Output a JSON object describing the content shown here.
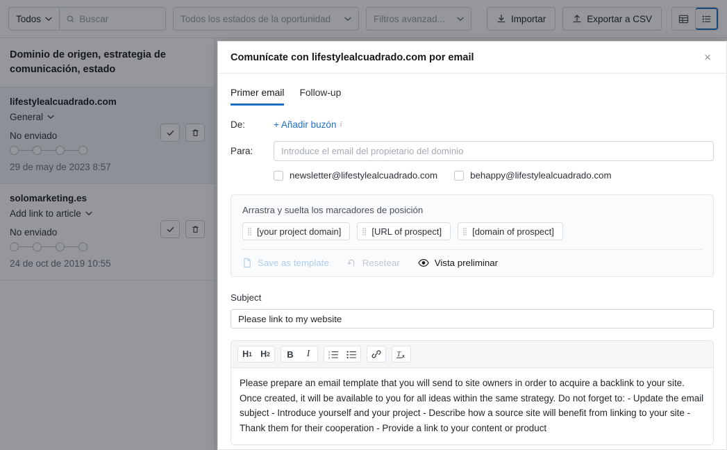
{
  "toolbar": {
    "filter_select": "Todos",
    "search_placeholder": "Buscar",
    "search_value": "",
    "opportunity_status": "Todos los estados de la oportunidad",
    "advanced_filters": "Filtros avanzad...",
    "import_label": "Importar",
    "export_label": "Exportar a CSV",
    "view_table": "table-view",
    "view_list": "list-view",
    "accent_color": "#1b6fc4"
  },
  "sidebar": {
    "header": "Dominio de origen, estrategia de comunicación, estado",
    "items": [
      {
        "domain": "lifestylealcuadrado.com",
        "strategy": "General",
        "status": "No enviado",
        "date": "29 de may de 2023 8:57",
        "steps": 4,
        "selected": true
      },
      {
        "domain": "solomarketing.es",
        "strategy": "Add link to article",
        "status": "No enviado",
        "date": "24 de oct de 2019 10:55",
        "steps": 4,
        "selected": false
      }
    ]
  },
  "modal": {
    "title": "Comunícate con lifestylealcuadrado.com por email",
    "close_label": "×",
    "tabs": [
      {
        "label": "Primer email",
        "active": true
      },
      {
        "label": "Follow-up",
        "active": false
      }
    ],
    "from": {
      "label": "De:",
      "add_mailbox": "+ Añadir buzón",
      "info_glyph": "i"
    },
    "to": {
      "label": "Para:",
      "placeholder": "Introduce el email del propietario del dominio",
      "value": "",
      "suggestions": [
        {
          "email": "newsletter@lifestylealcuadrado.com",
          "checked": false
        },
        {
          "email": "behappy@lifestylealcuadrado.com",
          "checked": false
        }
      ]
    },
    "placeholders": {
      "title": "Arrastra y suelta los marcadores de posición",
      "chips": [
        "[your project domain]",
        "[URL of prospect]",
        "[domain of prospect]"
      ],
      "actions": [
        {
          "label": "Save as template",
          "state": "disabled-blue",
          "icon": "document-icon"
        },
        {
          "label": "Resetear",
          "state": "disabled-grey",
          "icon": "undo-icon"
        },
        {
          "label": "Vista preliminar",
          "state": "enabled",
          "icon": "eye-icon"
        }
      ]
    },
    "subject": {
      "label": "Subject",
      "value": "Please link to my website"
    },
    "editor": {
      "tools": [
        {
          "name": "heading-1",
          "glyph": "H1"
        },
        {
          "name": "heading-2",
          "glyph": "H2"
        },
        {
          "name": "bold",
          "glyph": "B"
        },
        {
          "name": "italic",
          "glyph": "I"
        },
        {
          "name": "ordered-list",
          "glyph": ""
        },
        {
          "name": "bullet-list",
          "glyph": ""
        },
        {
          "name": "link",
          "glyph": ""
        },
        {
          "name": "clear-format",
          "glyph": ""
        }
      ],
      "body": "Please prepare an email template that you will send to site owners in order to acquire a backlink to your site. Once created, it will be available to you for all ideas within the same strategy. Do not forget to: - Update the email subject - Introduce yourself and your project - Describe how a source site will benefit from linking to your site - Thank them for their cooperation - Provide a link to your content or product"
    }
  }
}
